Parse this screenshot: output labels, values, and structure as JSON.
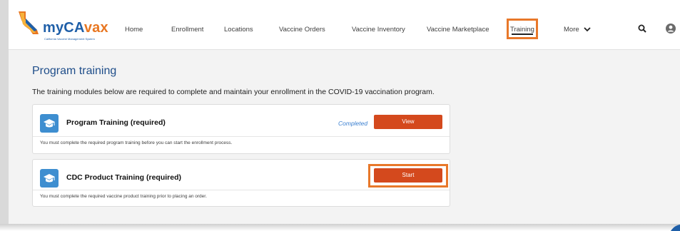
{
  "brand": {
    "name_part1": "myCA",
    "name_part2": "vax",
    "tagline": "California Vaccine Management System"
  },
  "nav": {
    "items": [
      "Home",
      "Enrollment",
      "Locations",
      "Vaccine Orders",
      "Vaccine Inventory",
      "Vaccine Marketplace"
    ],
    "training": "Training",
    "more": "More",
    "icons": [
      "search-icon",
      "user-avatar-icon"
    ]
  },
  "page": {
    "title": "Program training",
    "intro": "The training modules below are required to complete and maintain your enrollment in the COVID-19 vaccination program."
  },
  "cards": [
    {
      "title": "Program Training (required)",
      "status": "Completed",
      "button": "View",
      "description": "You must complete the required program training before you can start the enrollment process."
    },
    {
      "title": "CDC Product Training (required)",
      "button": "Start",
      "description": "You must complete the required vaccine product training prior to placing an order."
    }
  ],
  "colors": {
    "accent_button": "#d4491d",
    "highlight_box": "#e8782a",
    "title_blue": "#1f4e8a",
    "status_blue": "#3a7fd0",
    "icon_tile": "#3e8ed0"
  }
}
